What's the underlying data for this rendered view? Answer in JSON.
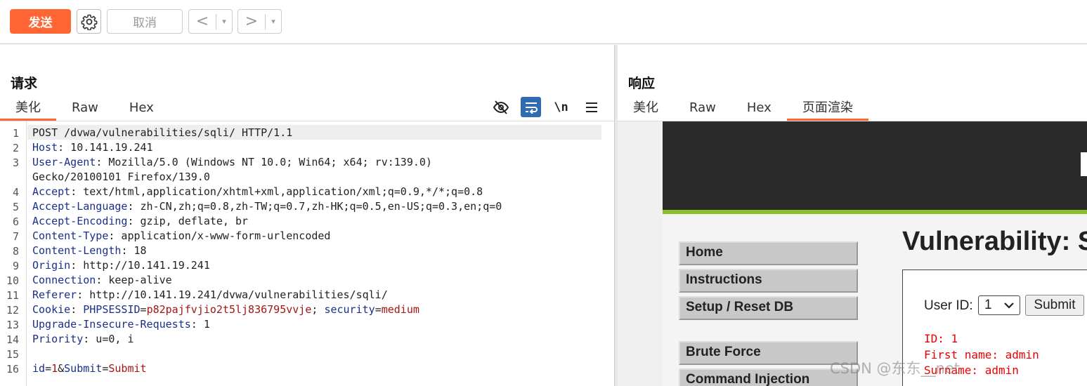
{
  "toolbar": {
    "send_label": "发送",
    "cancel_label": "取消",
    "back_arrow": "<",
    "forward_arrow": ">",
    "dropdown_glyph": "▾"
  },
  "request": {
    "title": "请求",
    "tabs": [
      "美化",
      "Raw",
      "Hex"
    ],
    "active_tab": "美化",
    "tool_icons": [
      "eye-slash-icon",
      "wrap-icon",
      "newline-icon",
      "menu-icon"
    ],
    "newline_label": "\\n",
    "lines": [
      {
        "n": "1",
        "parts": [
          {
            "t": "POST /dvwa/vulnerabilities/sqli/ HTTP/1.1",
            "c": "v"
          }
        ]
      },
      {
        "n": "2",
        "parts": [
          {
            "t": "Host",
            "c": "k"
          },
          {
            "t": ": 10.141.19.241",
            "c": "v"
          }
        ]
      },
      {
        "n": "3",
        "parts": [
          {
            "t": "User-Agent",
            "c": "k"
          },
          {
            "t": ": Mozilla/5.0 (Windows NT 10.0; Win64; x64; rv:139.0)",
            "c": "v"
          }
        ]
      },
      {
        "n": "",
        "parts": [
          {
            "t": "Gecko/20100101 Firefox/139.0",
            "c": "v"
          }
        ]
      },
      {
        "n": "4",
        "parts": [
          {
            "t": "Accept",
            "c": "k"
          },
          {
            "t": ": text/html,application/xhtml+xml,application/xml;q=0.9,*/*;q=0.8",
            "c": "v"
          }
        ]
      },
      {
        "n": "5",
        "parts": [
          {
            "t": "Accept-Language",
            "c": "k"
          },
          {
            "t": ": zh-CN,zh;q=0.8,zh-TW;q=0.7,zh-HK;q=0.5,en-US;q=0.3,en;q=0",
            "c": "v"
          }
        ]
      },
      {
        "n": "6",
        "parts": [
          {
            "t": "Accept-Encoding",
            "c": "k"
          },
          {
            "t": ": gzip, deflate, br",
            "c": "v"
          }
        ]
      },
      {
        "n": "7",
        "parts": [
          {
            "t": "Content-Type",
            "c": "k"
          },
          {
            "t": ": application/x-www-form-urlencoded",
            "c": "v"
          }
        ]
      },
      {
        "n": "8",
        "parts": [
          {
            "t": "Content-Length",
            "c": "k"
          },
          {
            "t": ": 18",
            "c": "v"
          }
        ]
      },
      {
        "n": "9",
        "parts": [
          {
            "t": "Origin",
            "c": "k"
          },
          {
            "t": ": http://10.141.19.241",
            "c": "v"
          }
        ]
      },
      {
        "n": "10",
        "parts": [
          {
            "t": "Connection",
            "c": "k"
          },
          {
            "t": ": keep-alive",
            "c": "v"
          }
        ]
      },
      {
        "n": "11",
        "parts": [
          {
            "t": "Referer",
            "c": "k"
          },
          {
            "t": ": http://10.141.19.241/dvwa/vulnerabilities/sqli/",
            "c": "v"
          }
        ]
      },
      {
        "n": "12",
        "parts": [
          {
            "t": "Cookie",
            "c": "k"
          },
          {
            "t": ": ",
            "c": "v"
          },
          {
            "t": "PHPSESSID",
            "c": "k"
          },
          {
            "t": "=",
            "c": "v"
          },
          {
            "t": "p82pajfvjio2t5lj836795vvje",
            "c": "r"
          },
          {
            "t": "; ",
            "c": "v"
          },
          {
            "t": "security",
            "c": "k"
          },
          {
            "t": "=",
            "c": "v"
          },
          {
            "t": "medium",
            "c": "r"
          }
        ]
      },
      {
        "n": "13",
        "parts": [
          {
            "t": "Upgrade-Insecure-Requests",
            "c": "k"
          },
          {
            "t": ": 1",
            "c": "v"
          }
        ]
      },
      {
        "n": "14",
        "parts": [
          {
            "t": "Priority",
            "c": "k"
          },
          {
            "t": ": u=0, i",
            "c": "v"
          }
        ]
      },
      {
        "n": "15",
        "parts": []
      },
      {
        "n": "16",
        "parts": [
          {
            "t": "id",
            "c": "k"
          },
          {
            "t": "=",
            "c": "v"
          },
          {
            "t": "1",
            "c": "r"
          },
          {
            "t": "&",
            "c": "v"
          },
          {
            "t": "Submit",
            "c": "k"
          },
          {
            "t": "=",
            "c": "v"
          },
          {
            "t": "Submit",
            "c": "r"
          }
        ]
      }
    ]
  },
  "response": {
    "title": "响应",
    "tabs": [
      "美化",
      "Raw",
      "Hex",
      "页面渲染"
    ],
    "active_tab": "页面渲染",
    "render": {
      "menu_items": [
        "Home",
        "Instructions",
        "Setup / Reset DB",
        "Brute Force",
        "Command Injection"
      ],
      "page_title": "Vulnerability: S",
      "user_id_label": "User ID:",
      "user_id_value": "1",
      "submit_label": "Submit",
      "results": [
        "ID: 1",
        "First name: admin",
        "Surname: admin"
      ]
    },
    "watermark": "CSDN @东东__net"
  },
  "colors": {
    "accent": "#ff6633",
    "key": "#1a2f8a",
    "value_red": "#a31515",
    "dvwa_green": "#8cbf26"
  }
}
